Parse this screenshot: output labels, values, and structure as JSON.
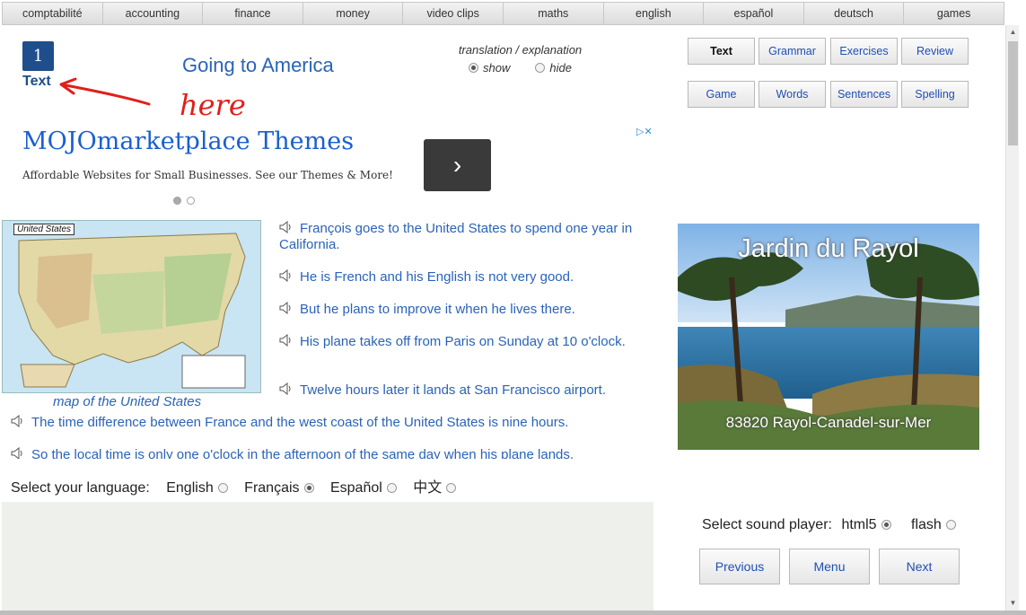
{
  "topnav": [
    "comptabilité",
    "accounting",
    "finance",
    "money",
    "video clips",
    "maths",
    "english",
    "español",
    "deutsch",
    "games"
  ],
  "lesson": {
    "number": "1",
    "label": "Text",
    "title": "Going to America",
    "annotation": "here"
  },
  "translation": {
    "heading": "translation / explanation",
    "show": "show",
    "hide": "hide"
  },
  "buttons": {
    "text": "Text",
    "grammar": "Grammar",
    "exercises": "Exercises",
    "review": "Review",
    "game": "Game",
    "words": "Words",
    "sentences": "Sentences",
    "spelling": "Spelling"
  },
  "ad": {
    "title": "MOJOmarketplace Themes",
    "subtitle": "Affordable Websites for Small Businesses. See our Themes & More!",
    "next": "›"
  },
  "map": {
    "label": "United States",
    "caption": "map of the United States"
  },
  "sentences": [
    "François goes to the United States to spend one year in California.",
    "He is French and his English is not very good.",
    "But he plans to improve it when he lives there.",
    "His plane takes off from Paris on Sunday at 10 o'clock.",
    "Twelve hours later it lands at San Francisco airport.",
    "The time difference between France and the west coast of the United States is nine hours.",
    "So the local time is only one o'clock in the afternoon of the same day when his plane lands."
  ],
  "language": {
    "label": "Select your language:",
    "english": "English",
    "francais": "Français",
    "espanol": "Español",
    "chinese": "中文"
  },
  "photo": {
    "title": "Jardin du Rayol",
    "subtitle": "83820 Rayol-Canadel-sur-Mer"
  },
  "sound": {
    "label": "Select sound player:",
    "html5": "html5",
    "flash": "flash"
  },
  "nav": {
    "previous": "Previous",
    "menu": "Menu",
    "next": "Next"
  }
}
